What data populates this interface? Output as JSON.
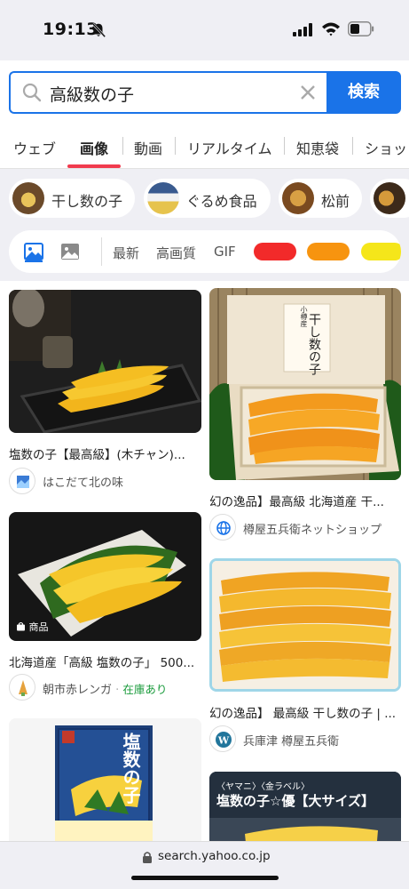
{
  "status_bar": {
    "time": "19:13"
  },
  "search": {
    "query": "高級数の子",
    "button_label": "検索"
  },
  "tabs": [
    {
      "label": "ウェブ",
      "active": false
    },
    {
      "label": "画像",
      "active": true
    },
    {
      "label": "動画",
      "active": false
    },
    {
      "label": "リアルタイム",
      "active": false
    },
    {
      "label": "知恵袋",
      "active": false
    },
    {
      "label": "ショッ",
      "active": false
    }
  ],
  "related": [
    {
      "label": "干し数の子"
    },
    {
      "label": "ぐるめ食品"
    },
    {
      "label": "松前"
    }
  ],
  "filters": {
    "options": [
      "最新",
      "高画質",
      "GIF"
    ],
    "color_swatches": [
      "#f22a2a",
      "#f7940f",
      "#f5e61a"
    ]
  },
  "results": {
    "left": [
      {
        "title": "塩数の子【最高級】(木チャン)...",
        "source": "はこだて北の味",
        "badge": "",
        "stock": ""
      },
      {
        "title": "北海道産「高級 塩数の子」 500...",
        "source": "朝市赤レンガ",
        "badge": "商品",
        "stock": "在庫あり"
      },
      {
        "title": "",
        "source": "",
        "badge": "",
        "stock": "",
        "image_text": "塩数の子"
      }
    ],
    "right": [
      {
        "title": "幻の逸品】最高級 北海道産 干...",
        "source": "樽屋五兵衛ネットショップ",
        "image_text": "干し数の子",
        "image_subtext": "小樽産"
      },
      {
        "title": "幻の逸品】 最高級 干し数の子 | ...",
        "source": "兵庫津 樽屋五兵衛"
      },
      {
        "title": "",
        "source": "",
        "image_text": "塩数の子☆優【大サイズ】",
        "image_subtext": "〈ヤマニ〉〈金ラベル〉"
      }
    ]
  },
  "urlbar": {
    "url": "search.yahoo.co.jp"
  }
}
